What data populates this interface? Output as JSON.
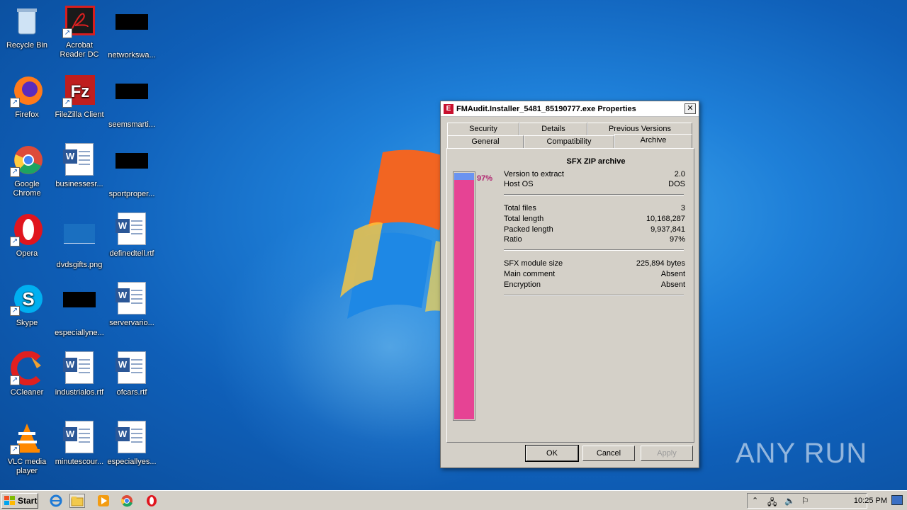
{
  "desktop": {
    "icons": [
      {
        "label": "Recycle Bin"
      },
      {
        "label": "Acrobat Reader DC"
      },
      {
        "label": "networkswa..."
      },
      {
        "label": "Firefox"
      },
      {
        "label": "FileZilla Client"
      },
      {
        "label": "seemsmarti..."
      },
      {
        "label": "Google Chrome"
      },
      {
        "label": "businessesr..."
      },
      {
        "label": "sportproper..."
      },
      {
        "label": "Opera"
      },
      {
        "label": "dvdsgifts.png"
      },
      {
        "label": "definedtell.rtf"
      },
      {
        "label": "Skype"
      },
      {
        "label": "especiallyne..."
      },
      {
        "label": "servervario..."
      },
      {
        "label": "CCleaner"
      },
      {
        "label": "industrialos.rtf"
      },
      {
        "label": "ofcars.rtf"
      },
      {
        "label": "VLC media player"
      },
      {
        "label": "minutescour..."
      },
      {
        "label": "especiallyes..."
      }
    ],
    "watermark": "ANY RUN"
  },
  "dialog": {
    "title": "FMAudit.Installer_5481_85190777.exe Properties",
    "close_label": "✕",
    "tabs_row1": [
      "Security",
      "Details",
      "Previous Versions"
    ],
    "tabs_row2": [
      "General",
      "Compatibility",
      "Archive"
    ],
    "active_tab": "Archive",
    "panel": {
      "heading": "SFX ZIP archive",
      "ratio_percent": 97,
      "ratio_label": "97%",
      "group1": [
        {
          "key": "Version to extract",
          "value": "2.0"
        },
        {
          "key": "Host OS",
          "value": "DOS"
        }
      ],
      "group2": [
        {
          "key": "Total files",
          "value": "3"
        },
        {
          "key": "Total length",
          "value": "10,168,287"
        },
        {
          "key": "Packed length",
          "value": "9,937,841"
        },
        {
          "key": "Ratio",
          "value": "97%"
        }
      ],
      "group3": [
        {
          "key": "SFX module size",
          "value": "225,894 bytes"
        },
        {
          "key": "Main comment",
          "value": "Absent"
        },
        {
          "key": "Encryption",
          "value": "Absent"
        }
      ]
    },
    "buttons": {
      "ok": "OK",
      "cancel": "Cancel",
      "apply": "Apply"
    }
  },
  "taskbar": {
    "start_label": "Start",
    "clock": "10:25 PM",
    "pinned": [
      "internet-explorer-icon",
      "explorer-icon",
      "media-player-icon",
      "chrome-icon",
      "opera-icon"
    ]
  }
}
